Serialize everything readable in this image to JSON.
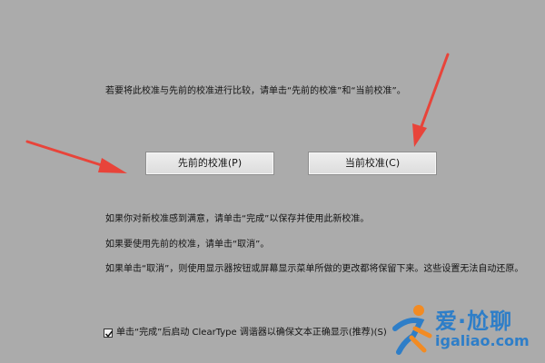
{
  "dialog": {
    "instruction": "若要将此校准与先前的校准进行比较，请单击“先前的校准”和“当前校准”。",
    "previous_button": "先前的校准(P)",
    "current_button": "当前校准(C)",
    "info_line1": "如果你对新校准感到满意，请单击“完成”以保存并使用此新校准。",
    "info_line2": "如果要使用先前的校准，请单击“取消”。",
    "info_line3": "如果单击“取消”，则使用显示器按钮或屏幕显示菜单所做的更改都将保留下来。这些设置无法自动还原。",
    "checkbox_label": "单击“完成”后启动 ClearType 调谐器以确保文本正确显示(推荐)(S)",
    "checkbox_checked": true
  },
  "annotations": {
    "arrow_color": "#e8443a"
  },
  "watermark": {
    "title": "爱·尬聊",
    "url": "igaliao.com"
  }
}
